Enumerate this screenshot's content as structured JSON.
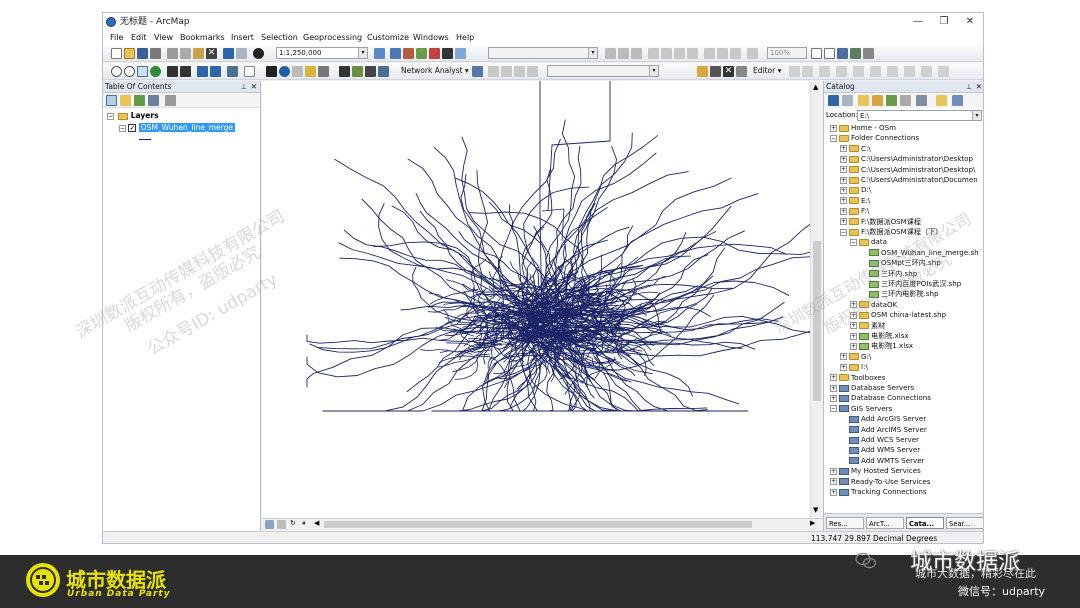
{
  "window": {
    "title": "无标题 - ArcMap"
  },
  "menu": [
    "File",
    "Edit",
    "View",
    "Bookmarks",
    "Insert",
    "Selection",
    "Geoprocessing",
    "Customize",
    "Windows",
    "Help"
  ],
  "toolbar": {
    "scale": "1:1,250,000",
    "zoom_percent": "100%",
    "network_analyst": "Network Analyst ▾",
    "editor": "Editor ▾"
  },
  "toc": {
    "title": "Table Of Contents",
    "root_layer": "Layers",
    "layer_name": "OSM_Wuhan_line_merge",
    "legend_line_color": "#1b2466"
  },
  "catalog": {
    "title": "Catalog",
    "location_label": "Location:",
    "location_value": "E:\\",
    "tree": [
      {
        "label": "Home - OSm",
        "indent": 0,
        "kind": "folder",
        "exp": "+"
      },
      {
        "label": "Folder Connections",
        "indent": 0,
        "kind": "folder",
        "exp": "−"
      },
      {
        "label": "C:\\",
        "indent": 1,
        "kind": "folder",
        "exp": "+"
      },
      {
        "label": "C:\\Users\\Administrator\\Desktop",
        "indent": 1,
        "kind": "folder",
        "exp": "+"
      },
      {
        "label": "C:\\Users\\Administrator\\Desktop\\",
        "indent": 1,
        "kind": "folder",
        "exp": "+"
      },
      {
        "label": "C:\\Users\\Administrator\\Documen",
        "indent": 1,
        "kind": "folder",
        "exp": "+"
      },
      {
        "label": "D:\\",
        "indent": 1,
        "kind": "folder",
        "exp": "+"
      },
      {
        "label": "E:\\",
        "indent": 1,
        "kind": "folder",
        "exp": "+"
      },
      {
        "label": "F:\\",
        "indent": 1,
        "kind": "folder",
        "exp": "+"
      },
      {
        "label": "F:\\数据派OSM课程",
        "indent": 1,
        "kind": "folder",
        "exp": "+"
      },
      {
        "label": "F:\\数据派OSM课程（下）",
        "indent": 1,
        "kind": "folder",
        "exp": "−"
      },
      {
        "label": "data",
        "indent": 2,
        "kind": "folder",
        "exp": "−"
      },
      {
        "label": "OSM_Wuhan_line_merge.sh",
        "indent": 3,
        "kind": "file",
        "exp": ""
      },
      {
        "label": "OSMpt三环内.shp",
        "indent": 3,
        "kind": "file",
        "exp": ""
      },
      {
        "label": "三环内.shp",
        "indent": 3,
        "kind": "file",
        "exp": ""
      },
      {
        "label": "三环内百度POIs武汉.shp",
        "indent": 3,
        "kind": "file",
        "exp": ""
      },
      {
        "label": "三环内电影院.shp",
        "indent": 3,
        "kind": "file",
        "exp": ""
      },
      {
        "label": "dataOK",
        "indent": 2,
        "kind": "folder",
        "exp": "+"
      },
      {
        "label": "OSM china-latest.shp",
        "indent": 2,
        "kind": "folder",
        "exp": "+"
      },
      {
        "label": "素材",
        "indent": 2,
        "kind": "folder",
        "exp": "+"
      },
      {
        "label": "电影院.xlsx",
        "indent": 2,
        "kind": "file",
        "exp": "+"
      },
      {
        "label": "电影院1.xlsx",
        "indent": 2,
        "kind": "file",
        "exp": "+"
      },
      {
        "label": "G:\\",
        "indent": 1,
        "kind": "folder",
        "exp": "+"
      },
      {
        "label": "I:\\",
        "indent": 1,
        "kind": "folder",
        "exp": "+"
      },
      {
        "label": "Toolboxes",
        "indent": 0,
        "kind": "folder",
        "exp": "+"
      },
      {
        "label": "Database Servers",
        "indent": 0,
        "kind": "server",
        "exp": "+"
      },
      {
        "label": "Database Connections",
        "indent": 0,
        "kind": "server",
        "exp": "+"
      },
      {
        "label": "GIS Servers",
        "indent": 0,
        "kind": "server",
        "exp": "−"
      },
      {
        "label": "Add ArcGIS Server",
        "indent": 1,
        "kind": "server",
        "exp": ""
      },
      {
        "label": "Add ArcIMS Server",
        "indent": 1,
        "kind": "server",
        "exp": ""
      },
      {
        "label": "Add WCS Server",
        "indent": 1,
        "kind": "server",
        "exp": ""
      },
      {
        "label": "Add WMS Server",
        "indent": 1,
        "kind": "server",
        "exp": ""
      },
      {
        "label": "Add WMTS Server",
        "indent": 1,
        "kind": "server",
        "exp": ""
      },
      {
        "label": "My Hosted Services",
        "indent": 0,
        "kind": "server",
        "exp": "+"
      },
      {
        "label": "Ready-To-Use Services",
        "indent": 0,
        "kind": "server",
        "exp": "+"
      },
      {
        "label": "Tracking Connections",
        "indent": 0,
        "kind": "server",
        "exp": "+"
      }
    ],
    "tabs": [
      "Res...",
      "ArcT...",
      "Cata...",
      "Sear..."
    ]
  },
  "status": {
    "coords": "113.747  29.897 Decimal Degrees"
  },
  "footer": {
    "logo_title": "城市数据派",
    "logo_sub": "Urban Data Party",
    "brand_big": "城市数据派",
    "brand_sub1": "城市大数据，精彩尽在此",
    "brand_sub2": "微信号：udparty"
  },
  "watermarks": [
    "深圳数派互动传媒科技有限公司",
    "版权所有，盗版必究",
    "公众号ID: udparty"
  ],
  "colors": {
    "map_line": "#1b2466",
    "logo_yellow": "#e8e400",
    "footer_bg": "#2d2d2d"
  }
}
